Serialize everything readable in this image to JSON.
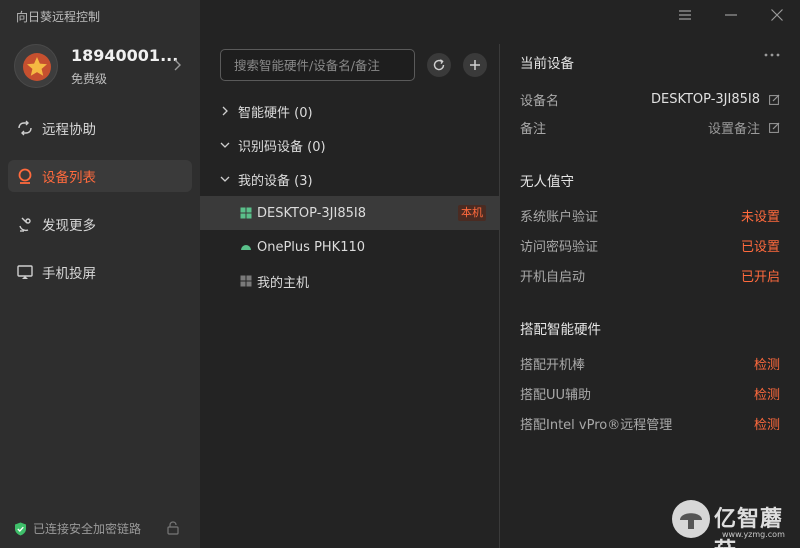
{
  "app": {
    "title": "向日葵远程控制"
  },
  "profile": {
    "name": "18940001...",
    "level": "免费级"
  },
  "nav": [
    {
      "label": "远程协助",
      "icon": "remote-assist-icon"
    },
    {
      "label": "设备列表",
      "icon": "device-list-icon",
      "active": true
    },
    {
      "label": "发现更多",
      "icon": "discover-icon"
    },
    {
      "label": "手机投屏",
      "icon": "screen-cast-icon"
    }
  ],
  "status": {
    "connection": "已连接安全加密链路"
  },
  "search": {
    "placeholder": "搜索智能硬件/设备名/备注"
  },
  "groups": [
    {
      "label": "智能硬件 (0)",
      "expanded": false
    },
    {
      "label": "识别码设备 (0)",
      "expanded": true
    },
    {
      "label": "我的设备 (3)",
      "expanded": true
    }
  ],
  "devices": [
    {
      "name": "DESKTOP-3JI85I8",
      "icon": "windows-icon",
      "badge": "本机",
      "selected": true,
      "color": "#5ac08a"
    },
    {
      "name": "OnePlus PHK110",
      "icon": "android-icon",
      "color": "#5ac08a"
    },
    {
      "name": "我的主机",
      "icon": "windows-icon",
      "color": "#7a7a7a"
    }
  ],
  "details": {
    "current_device": {
      "title": "当前设备",
      "name_label": "设备名",
      "name_value": "DESKTOP-3JI85I8",
      "note_label": "备注",
      "note_value": "设置备注"
    },
    "unattended": {
      "title": "无人值守",
      "rows": [
        {
          "label": "系统账户验证",
          "value": "未设置"
        },
        {
          "label": "访问密码验证",
          "value": "已设置"
        },
        {
          "label": "开机自启动",
          "value": "已开启"
        }
      ]
    },
    "hardware": {
      "title": "搭配智能硬件",
      "rows": [
        {
          "label": "搭配开机棒",
          "value": "检测"
        },
        {
          "label": "搭配UU辅助",
          "value": "检测"
        },
        {
          "label": "搭配Intel vPro®远程管理",
          "value": "检测"
        }
      ]
    }
  },
  "watermark": {
    "text": "亿智蘑菇",
    "url": "www.yzmg.com"
  },
  "colors": {
    "accent": "#ff6a3d",
    "sidebar_bg": "#2e2e2e",
    "main_bg": "#232323",
    "selected_bg": "#3a3a3a"
  }
}
